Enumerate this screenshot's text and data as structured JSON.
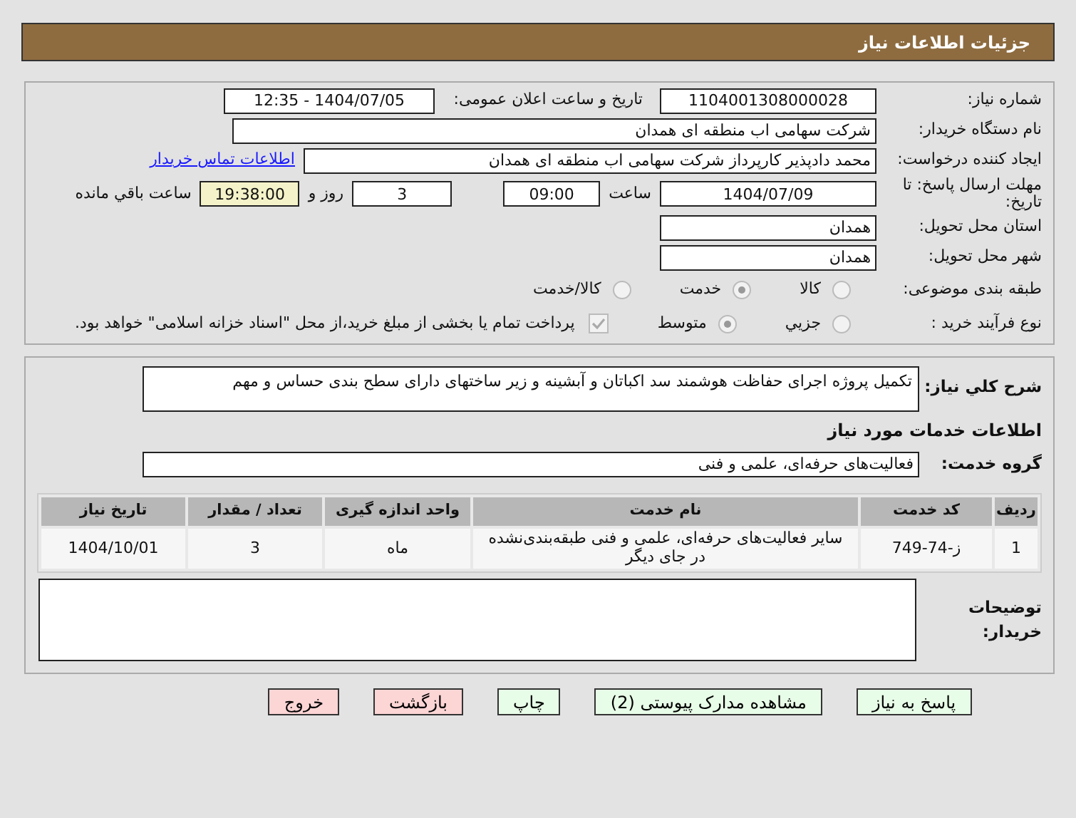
{
  "header": {
    "title": "جزئیات اطلاعات نیاز"
  },
  "details": {
    "need_number": {
      "label": "شماره نیاز:",
      "value": "1104001308000028"
    },
    "announce": {
      "label": "تاریخ و ساعت اعلان عمومی:",
      "value": "1404/07/05 - 12:35"
    },
    "buyer": {
      "label": "نام دستگاه خریدار:",
      "value": "شرکت سهامی اب منطقه ای همدان"
    },
    "creator": {
      "label": "ایجاد کننده درخواست:",
      "value": "محمد دادپذیر کارپرداز شرکت سهامی اب منطقه ای همدان",
      "link": "اطلاعات تماس خریدار"
    },
    "deadline": {
      "label": "مهلت ارسال پاسخ: تا تاریخ:",
      "date": "1404/07/09",
      "time_label": "ساعت",
      "time": "09:00",
      "days": "3",
      "days_label": "روز و",
      "remaining": "19:38:00",
      "remaining_label": "ساعت باقي مانده"
    },
    "province": {
      "label": "استان محل تحویل:",
      "value": "همدان"
    },
    "city": {
      "label": "شهر محل تحویل:",
      "value": "همدان"
    },
    "category": {
      "label": "طبقه بندی موضوعی:",
      "options": [
        {
          "label": "کالا",
          "selected": false
        },
        {
          "label": "خدمت",
          "selected": true
        },
        {
          "label": "کالا/خدمت",
          "selected": false
        }
      ]
    },
    "process": {
      "label": "نوع فرآیند خرید :",
      "options": [
        {
          "label": "جزیي",
          "selected": false
        },
        {
          "label": "متوسط",
          "selected": true
        }
      ],
      "payment": {
        "checked": true,
        "text": "پرداخت تمام یا بخشی از مبلغ خرید،از محل \"اسناد خزانه اسلامی\" خواهد بود."
      }
    }
  },
  "services": {
    "description": {
      "label": "شرح كلي نیاز:",
      "value": "تکمیل پروژه اجرای حفاظت هوشمند سد اکباتان و آبشینه و زیر ساختهای دارای سطح بندی حساس و مهم"
    },
    "section_title": "اطلاعات خدمات مورد نیاز",
    "group": {
      "label": "گروه خدمت:",
      "value": "فعالیت‌های حرفه‌ای، علمی و فنی"
    },
    "table": {
      "columns": [
        "ردیف",
        "کد خدمت",
        "نام خدمت",
        "واحد اندازه گیری",
        "تعداد / مقدار",
        "تاریخ نیاز"
      ],
      "rows": [
        [
          "1",
          "ز-74-749",
          "سایر فعالیت‌های حرفه‌ای، علمی و فنی طبقه‌بندی‌نشده در جای دیگر",
          "ماه",
          "3",
          "1404/10/01"
        ]
      ]
    },
    "notes": {
      "label": "توضیحات خریدار:"
    }
  },
  "buttons": [
    {
      "label": "پاسخ به نیاز",
      "kind": "action"
    },
    {
      "label": "مشاهده مدارک پیوستی (2)",
      "kind": "action"
    },
    {
      "label": "چاپ",
      "kind": "action"
    },
    {
      "label": "بازگشت",
      "kind": "exit"
    },
    {
      "label": "خروج",
      "kind": "exit"
    }
  ]
}
